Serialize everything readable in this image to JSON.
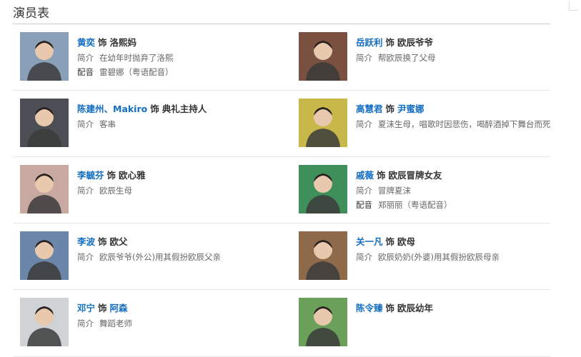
{
  "section_title": "演员表",
  "shi": "饰",
  "rows": [
    [
      {
        "actor": "黄奕",
        "role": "洛熙妈",
        "role_link": false,
        "lines": [
          {
            "label": "简介",
            "text": "在幼年时抛弃了洛熙"
          },
          {
            "label": "配音",
            "text": "雷碧娜（粤语配音）"
          }
        ]
      },
      {
        "actor": "岳跃利",
        "role": "欧辰爷爷",
        "role_link": false,
        "lines": [
          {
            "label": "简介",
            "text": "帮欧辰换了父母"
          }
        ]
      }
    ],
    [
      {
        "actor": "陈建州、Makiro",
        "role": "典礼主持人",
        "role_link": false,
        "lines": [
          {
            "label": "简介",
            "text": "客串"
          }
        ]
      },
      {
        "actor": "高慧君",
        "role": "尹蜜娜",
        "role_link": true,
        "lines": [
          {
            "label": "简介",
            "text": "夏沫生母，唱歌时因悲伤，喝醉酒掉下舞台而死"
          }
        ]
      }
    ],
    [
      {
        "actor": "李毓芬",
        "role": "欧心雅",
        "role_link": false,
        "lines": [
          {
            "label": "简介",
            "text": "欧辰生母"
          }
        ]
      },
      {
        "actor": "戚薇",
        "role": "欧辰冒牌女友",
        "role_link": false,
        "lines": [
          {
            "label": "简介",
            "text": "冒牌夏沫"
          },
          {
            "label": "配音",
            "text": "郑丽丽（粤语配音）"
          }
        ]
      }
    ],
    [
      {
        "actor": "李波",
        "role": "欧父",
        "role_link": false,
        "lines": [
          {
            "label": "简介",
            "text": "欧辰爷爷(外公)用其假扮欧辰父亲"
          }
        ]
      },
      {
        "actor": "关一凡",
        "role": "欧母",
        "role_link": false,
        "lines": [
          {
            "label": "简介",
            "text": "欧辰奶奶(外婆)用其假扮欧辰母亲"
          }
        ]
      }
    ],
    [
      {
        "actor": "邓宁",
        "role": "阿森",
        "role_link": true,
        "lines": [
          {
            "label": "简介",
            "text": "舞蹈老师"
          }
        ]
      },
      {
        "actor": "陈令臻",
        "role": "欧辰幼年",
        "role_link": false,
        "lines": []
      }
    ]
  ],
  "photo_colors": [
    [
      "#8aa0b8",
      "#7a5040"
    ],
    [
      "#4b4f55",
      "#c8b84a"
    ],
    [
      "#c7a9a2",
      "#3f8f5a"
    ],
    [
      "#6b86a8",
      "#8f6a4a"
    ],
    [
      "#cfd3d6",
      "#6aa05a"
    ]
  ]
}
